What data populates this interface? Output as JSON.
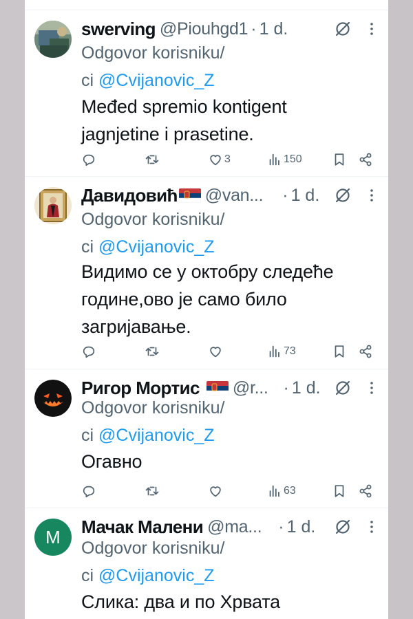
{
  "reply_prefix": "Odgovor korisniku/",
  "reply_prefix_2": "ci",
  "reply_mention": "@Cvijanovic_Z",
  "colors": {
    "link": "#1d9bf0",
    "muted": "#536471",
    "text": "#0f1419"
  },
  "tweets": [
    {
      "display_name": "swerving",
      "handle": "@Piouhgd1",
      "separator": "·",
      "time": "1 d.",
      "text_lines": [
        "Međed spremio kontigent",
        "jagnjetine i prasetine."
      ],
      "likes": "3",
      "views": "150",
      "has_flag": false
    },
    {
      "display_name": "Давидовић",
      "handle": "@van...",
      "separator": "·",
      "time": "1 d.",
      "text_lines": [
        "Видимо се у октобру следеће",
        "године,ово је само било",
        "загријавање."
      ],
      "likes": "",
      "views": "73",
      "has_flag": true
    },
    {
      "display_name": "Ригор Мортис",
      "handle": "@r...",
      "separator": "·",
      "time": "1 d.",
      "text_lines": [
        "Огавно"
      ],
      "likes": "",
      "views": "63",
      "has_flag": true
    },
    {
      "display_name": "Мачак Малени",
      "handle": "@ma...",
      "separator": "·",
      "time": "1 d.",
      "text_lines": [
        "Слика: два и по Хрвата"
      ],
      "likes": "",
      "views": "",
      "has_flag": false,
      "avatar_letter": "M",
      "avatar_color": "#16875f"
    }
  ]
}
